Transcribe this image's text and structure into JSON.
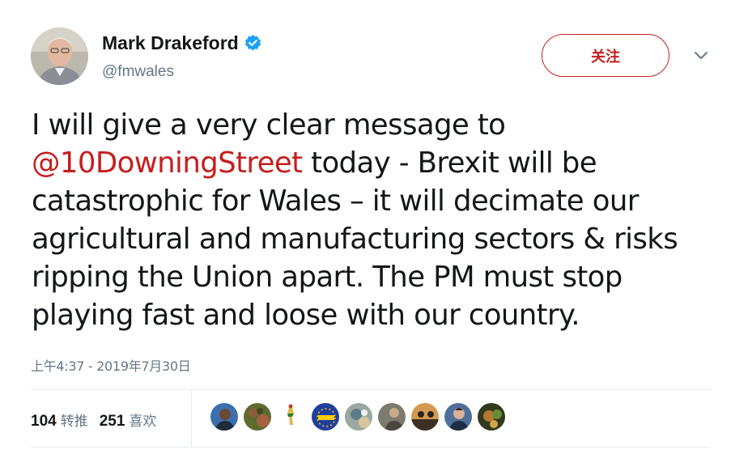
{
  "tweet": {
    "display_name": "Mark Drakeford",
    "handle": "@fmwales",
    "follow_label": "关注",
    "text_parts": {
      "intro": "I will give a very clear message to ",
      "mention": "@10DowningStreet",
      "rest": " today - Brexit will be catastrophic for Wales – it will decimate our agricultural and manufacturing sectors & risks ripping the Union apart. The PM must stop playing fast and loose with our country."
    },
    "timestamp": "上午4:37 - 2019年7月30日",
    "retweets": {
      "count": "104",
      "label": "转推"
    },
    "likes": {
      "count": "251",
      "label": "喜欢"
    },
    "likers": [
      "avatar",
      "avatar",
      "avatar",
      "avatar",
      "avatar",
      "avatar",
      "avatar",
      "avatar",
      "avatar"
    ]
  },
  "colors": {
    "accent": "#c61e1e",
    "verified": "#1da1f2",
    "secondary_text": "#657786"
  },
  "icons": {
    "verified": "verified-badge-icon",
    "chevron": "chevron-down-icon"
  }
}
